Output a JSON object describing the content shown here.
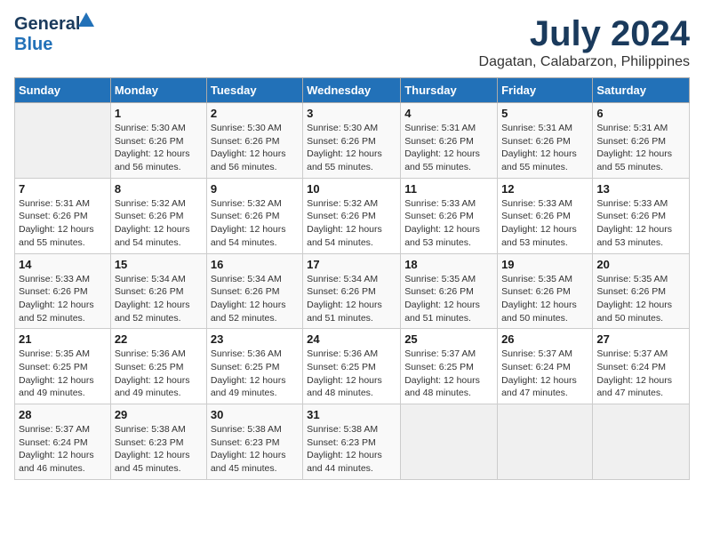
{
  "header": {
    "logo_general": "General",
    "logo_blue": "Blue",
    "month": "July 2024",
    "location": "Dagatan, Calabarzon, Philippines"
  },
  "weekdays": [
    "Sunday",
    "Monday",
    "Tuesday",
    "Wednesday",
    "Thursday",
    "Friday",
    "Saturday"
  ],
  "weeks": [
    [
      {
        "day": "",
        "info": ""
      },
      {
        "day": "1",
        "info": "Sunrise: 5:30 AM\nSunset: 6:26 PM\nDaylight: 12 hours\nand 56 minutes."
      },
      {
        "day": "2",
        "info": "Sunrise: 5:30 AM\nSunset: 6:26 PM\nDaylight: 12 hours\nand 56 minutes."
      },
      {
        "day": "3",
        "info": "Sunrise: 5:30 AM\nSunset: 6:26 PM\nDaylight: 12 hours\nand 55 minutes."
      },
      {
        "day": "4",
        "info": "Sunrise: 5:31 AM\nSunset: 6:26 PM\nDaylight: 12 hours\nand 55 minutes."
      },
      {
        "day": "5",
        "info": "Sunrise: 5:31 AM\nSunset: 6:26 PM\nDaylight: 12 hours\nand 55 minutes."
      },
      {
        "day": "6",
        "info": "Sunrise: 5:31 AM\nSunset: 6:26 PM\nDaylight: 12 hours\nand 55 minutes."
      }
    ],
    [
      {
        "day": "7",
        "info": "Sunrise: 5:31 AM\nSunset: 6:26 PM\nDaylight: 12 hours\nand 55 minutes."
      },
      {
        "day": "8",
        "info": "Sunrise: 5:32 AM\nSunset: 6:26 PM\nDaylight: 12 hours\nand 54 minutes."
      },
      {
        "day": "9",
        "info": "Sunrise: 5:32 AM\nSunset: 6:26 PM\nDaylight: 12 hours\nand 54 minutes."
      },
      {
        "day": "10",
        "info": "Sunrise: 5:32 AM\nSunset: 6:26 PM\nDaylight: 12 hours\nand 54 minutes."
      },
      {
        "day": "11",
        "info": "Sunrise: 5:33 AM\nSunset: 6:26 PM\nDaylight: 12 hours\nand 53 minutes."
      },
      {
        "day": "12",
        "info": "Sunrise: 5:33 AM\nSunset: 6:26 PM\nDaylight: 12 hours\nand 53 minutes."
      },
      {
        "day": "13",
        "info": "Sunrise: 5:33 AM\nSunset: 6:26 PM\nDaylight: 12 hours\nand 53 minutes."
      }
    ],
    [
      {
        "day": "14",
        "info": "Sunrise: 5:33 AM\nSunset: 6:26 PM\nDaylight: 12 hours\nand 52 minutes."
      },
      {
        "day": "15",
        "info": "Sunrise: 5:34 AM\nSunset: 6:26 PM\nDaylight: 12 hours\nand 52 minutes."
      },
      {
        "day": "16",
        "info": "Sunrise: 5:34 AM\nSunset: 6:26 PM\nDaylight: 12 hours\nand 52 minutes."
      },
      {
        "day": "17",
        "info": "Sunrise: 5:34 AM\nSunset: 6:26 PM\nDaylight: 12 hours\nand 51 minutes."
      },
      {
        "day": "18",
        "info": "Sunrise: 5:35 AM\nSunset: 6:26 PM\nDaylight: 12 hours\nand 51 minutes."
      },
      {
        "day": "19",
        "info": "Sunrise: 5:35 AM\nSunset: 6:26 PM\nDaylight: 12 hours\nand 50 minutes."
      },
      {
        "day": "20",
        "info": "Sunrise: 5:35 AM\nSunset: 6:26 PM\nDaylight: 12 hours\nand 50 minutes."
      }
    ],
    [
      {
        "day": "21",
        "info": "Sunrise: 5:35 AM\nSunset: 6:25 PM\nDaylight: 12 hours\nand 49 minutes."
      },
      {
        "day": "22",
        "info": "Sunrise: 5:36 AM\nSunset: 6:25 PM\nDaylight: 12 hours\nand 49 minutes."
      },
      {
        "day": "23",
        "info": "Sunrise: 5:36 AM\nSunset: 6:25 PM\nDaylight: 12 hours\nand 49 minutes."
      },
      {
        "day": "24",
        "info": "Sunrise: 5:36 AM\nSunset: 6:25 PM\nDaylight: 12 hours\nand 48 minutes."
      },
      {
        "day": "25",
        "info": "Sunrise: 5:37 AM\nSunset: 6:25 PM\nDaylight: 12 hours\nand 48 minutes."
      },
      {
        "day": "26",
        "info": "Sunrise: 5:37 AM\nSunset: 6:24 PM\nDaylight: 12 hours\nand 47 minutes."
      },
      {
        "day": "27",
        "info": "Sunrise: 5:37 AM\nSunset: 6:24 PM\nDaylight: 12 hours\nand 47 minutes."
      }
    ],
    [
      {
        "day": "28",
        "info": "Sunrise: 5:37 AM\nSunset: 6:24 PM\nDaylight: 12 hours\nand 46 minutes."
      },
      {
        "day": "29",
        "info": "Sunrise: 5:38 AM\nSunset: 6:23 PM\nDaylight: 12 hours\nand 45 minutes."
      },
      {
        "day": "30",
        "info": "Sunrise: 5:38 AM\nSunset: 6:23 PM\nDaylight: 12 hours\nand 45 minutes."
      },
      {
        "day": "31",
        "info": "Sunrise: 5:38 AM\nSunset: 6:23 PM\nDaylight: 12 hours\nand 44 minutes."
      },
      {
        "day": "",
        "info": ""
      },
      {
        "day": "",
        "info": ""
      },
      {
        "day": "",
        "info": ""
      }
    ]
  ]
}
